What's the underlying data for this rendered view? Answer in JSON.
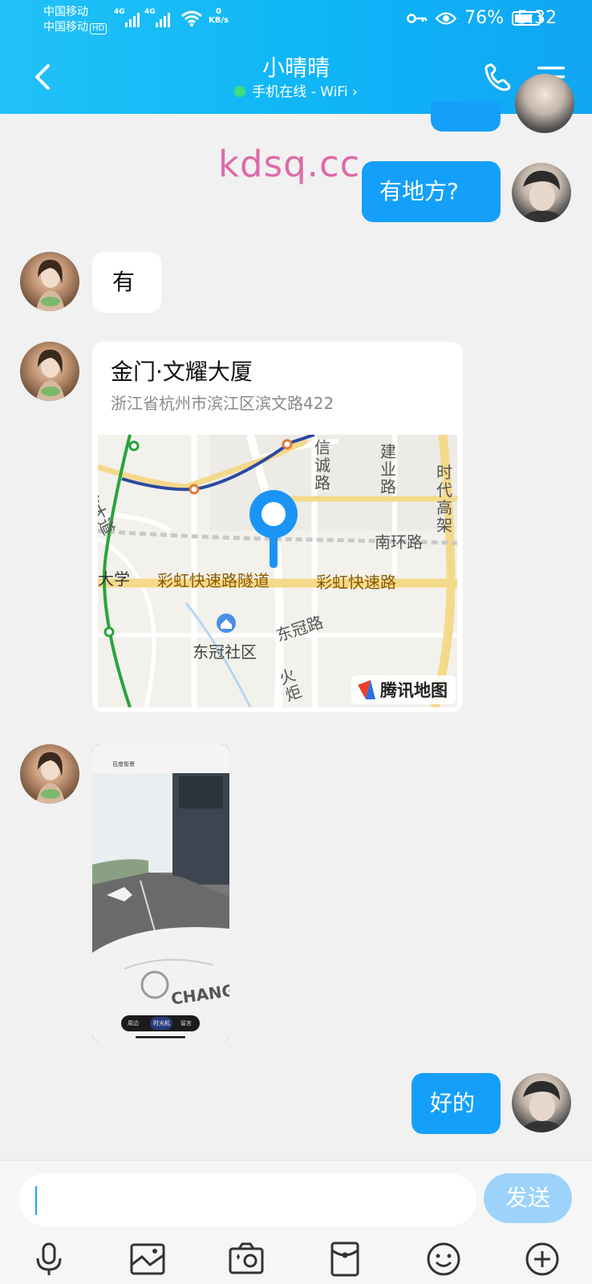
{
  "status_bar": {
    "carrier1": "中国移动",
    "carrier2": "中国移动",
    "hd": "HD",
    "net1": "4G",
    "net2": "4G",
    "speed_value": "0",
    "speed_unit": "KB/s",
    "battery": "76%",
    "battery_level": 0.76,
    "time": "5:32"
  },
  "header": {
    "title": "小晴晴",
    "subtitle": "手机在线 - WiFi",
    "subtitle_arrow": "›"
  },
  "watermark": "kdsq.cc",
  "messages": {
    "m1": "有地方?",
    "m2": "有",
    "m3": "好的"
  },
  "location": {
    "name": "金门·文耀大厦",
    "address": "浙江省杭州市滨江区滨文路422",
    "map_labels": {
      "xincheng": "信诚路",
      "jianye": "建业路",
      "shidai": "时代高架",
      "donxin": "东信大道",
      "nanhuan": "南环路",
      "daxue": "大学",
      "tunnel": "彩虹快速路隧道",
      "caihong": "彩虹快速路",
      "dongguan_road": "东冠路",
      "dongguan_community": "东冠社区",
      "huoju": "火炬",
      "brand": "腾讯地图"
    }
  },
  "photo_overlay": {
    "title": "百度街景",
    "tabs": [
      "周边",
      "时光机",
      "留言"
    ],
    "brand": "CHANG"
  },
  "input": {
    "placeholder": "",
    "send": "发送"
  },
  "colors": {
    "header_blue": "#10b4f6",
    "bubble_out": "#14a0fa",
    "send_disabled": "#9dd3fb",
    "online_dot": "#41dc7b"
  },
  "icons": [
    "back-icon",
    "phone-icon",
    "menu-icon",
    "mic-icon",
    "image-icon",
    "camera-icon",
    "red-packet-icon",
    "emoji-icon",
    "plus-icon"
  ]
}
